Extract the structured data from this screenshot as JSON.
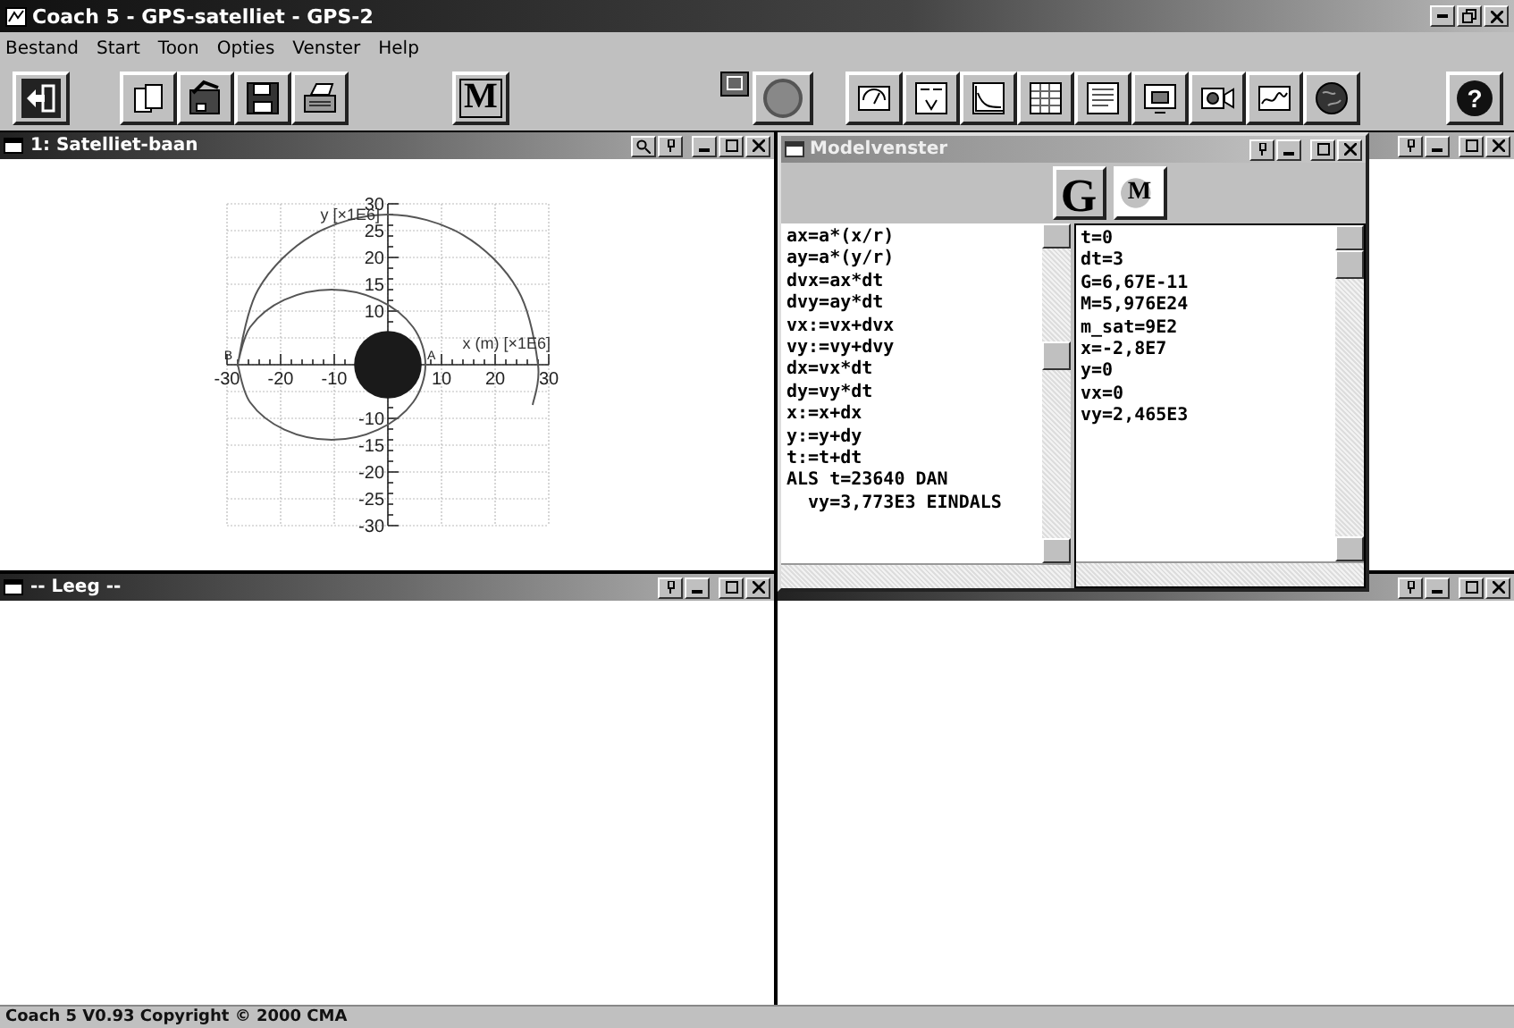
{
  "window": {
    "title": "Coach 5 - GPS-satelliet - GPS-2"
  },
  "menu": [
    "Bestand",
    "Start",
    "Toon",
    "Opties",
    "Venster",
    "Help"
  ],
  "toolbar": {
    "model_button": "M",
    "help_button": "?"
  },
  "panes": [
    {
      "title": "1: Satelliet-baan",
      "kind": "graph"
    },
    {
      "kind": "empty"
    },
    {
      "title": "-- Leeg --",
      "kind": "empty"
    },
    {
      "kind": "empty"
    }
  ],
  "graph": {
    "chart_data": {
      "type": "line",
      "xlabel": "x (m) [×1E6]",
      "ylabel": "y [×1E6]",
      "x": [
        -28,
        -25.7,
        -19.3,
        -10.5,
        -1.8,
        4.7,
        7,
        4.7,
        -1.8,
        -10.5,
        -19.3,
        -25.7,
        -28,
        -24.2,
        -14,
        0,
        14,
        24.2,
        28,
        27
      ],
      "series": [
        {
          "color": "#555555",
          "values": [
            0,
            -7,
            -12.1,
            -14,
            -12.1,
            -7,
            0,
            7,
            12.1,
            14,
            12.1,
            7,
            0,
            14,
            24.2,
            28,
            24.2,
            14,
            0,
            -7.5
          ]
        }
      ],
      "xlim": [
        -30,
        30
      ],
      "ylim": [
        -30,
        30
      ],
      "xticks": [
        -30,
        -20,
        -10,
        10,
        20,
        30
      ],
      "yticks": [
        -30,
        -25,
        -20,
        -15,
        -10,
        10,
        15,
        20,
        25,
        30
      ],
      "grid": true,
      "annotations": [
        {
          "text": "A",
          "x": 7,
          "y": 0
        },
        {
          "text": "B",
          "x": -28,
          "y": 0
        }
      ]
    }
  },
  "model_window": {
    "title": "Modelvenster",
    "buttons": [
      "G",
      "M"
    ],
    "equations": [
      "ax=a*(x/r)",
      "ay=a*(y/r)",
      "dvx=ax*dt",
      "dvy=ay*dt",
      "vx:=vx+dvx",
      "vy:=vy+dvy",
      "dx=vx*dt",
      "dy=vy*dt",
      "x:=x+dx",
      "y:=y+dy",
      "t:=t+dt",
      "ALS t=23640 DAN",
      "  vy=3,773E3 EINDALS"
    ],
    "initial_values": [
      "t=0",
      "dt=3",
      "G=6,67E-11",
      "M=5,976E24",
      "m_sat=9E2",
      "x=-2,8E7",
      "y=0",
      "vx=0",
      "vy=2,465E3"
    ]
  },
  "status_bar": "Coach 5 V0.93 Copyright © 2000 CMA"
}
